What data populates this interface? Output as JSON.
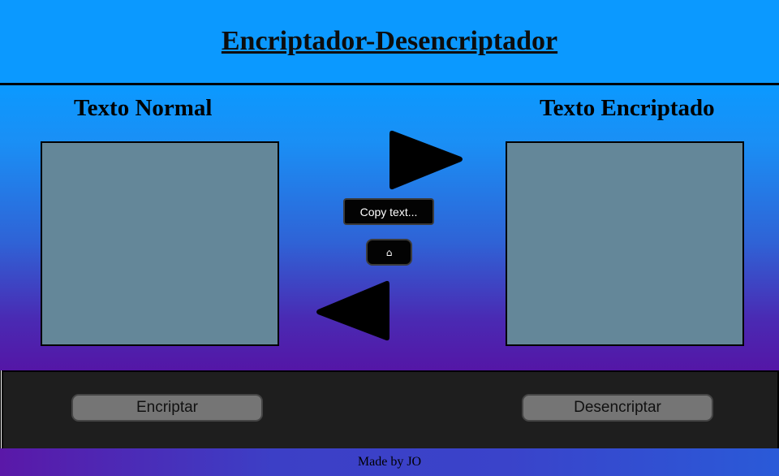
{
  "header": {
    "title": "Encriptador-Desencriptador"
  },
  "panels": {
    "left": {
      "title": "Texto Normal",
      "text": ""
    },
    "right": {
      "title": "Texto Encriptado",
      "text": ""
    }
  },
  "controls": {
    "copy_label": "Copy text...",
    "home_label": "⌂"
  },
  "toolbar": {
    "encrypt_label": "Encriptar",
    "decrypt_label": "Desencriptar"
  },
  "footer": {
    "credit": "Made by JO"
  },
  "colors": {
    "header_bg": "#0b99ff",
    "textarea_bg": "#648799",
    "toolbar_bg": "#1e1e1e",
    "button_bg": "#757575"
  },
  "icons": [
    "arrow-right-icon",
    "arrow-left-icon",
    "home-icon"
  ]
}
